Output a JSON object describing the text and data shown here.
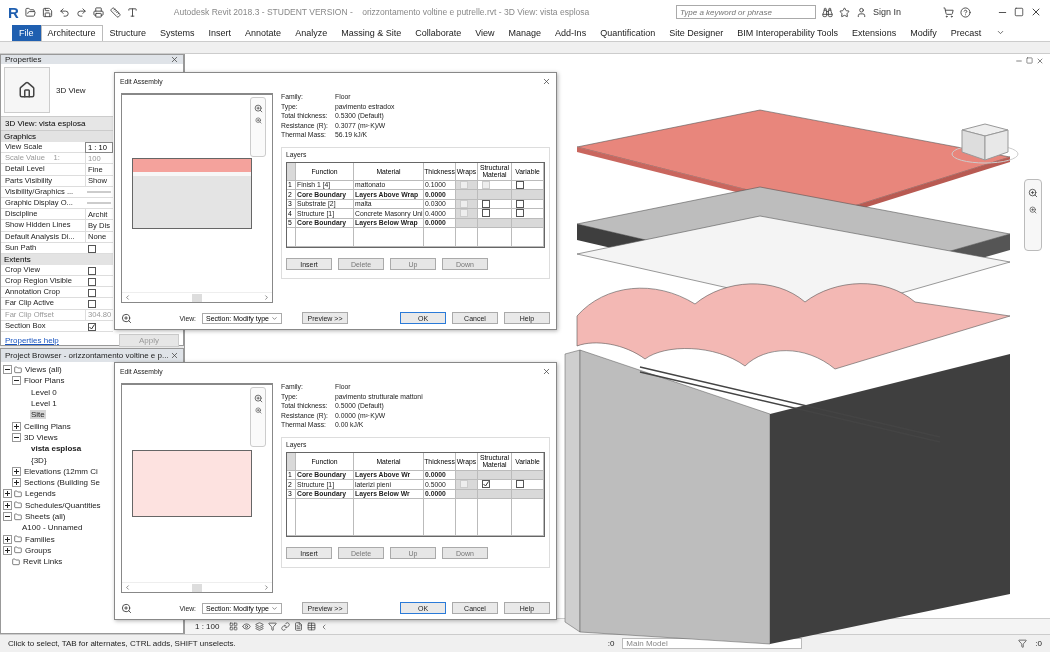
{
  "title_bar": {
    "logo": "R",
    "title": "Autodesk Revit 2018.3 - STUDENT VERSION -    orizzontamento voltine e putrelle.rvt - 3D View: vista esplosa",
    "search": {
      "placeholder": "Type a keyword or phrase"
    },
    "sign_in": "Sign In"
  },
  "ribbon_tabs": [
    {
      "label": "File",
      "kind": "file",
      "selected": false
    },
    {
      "label": "Architecture",
      "kind": "tab",
      "selected": true
    },
    {
      "label": "Structure",
      "kind": "tab",
      "selected": false
    },
    {
      "label": "Systems",
      "kind": "tab",
      "selected": false
    },
    {
      "label": "Insert",
      "kind": "tab",
      "selected": false
    },
    {
      "label": "Annotate",
      "kind": "tab",
      "selected": false
    },
    {
      "label": "Analyze",
      "kind": "tab",
      "selected": false
    },
    {
      "label": "Massing & Site",
      "kind": "tab",
      "selected": false
    },
    {
      "label": "Collaborate",
      "kind": "tab",
      "selected": false
    },
    {
      "label": "View",
      "kind": "tab",
      "selected": false
    },
    {
      "label": "Manage",
      "kind": "tab",
      "selected": false
    },
    {
      "label": "Add-Ins",
      "kind": "tab",
      "selected": false
    },
    {
      "label": "Quantification",
      "kind": "tab",
      "selected": false
    },
    {
      "label": "Site Designer",
      "kind": "tab",
      "selected": false
    },
    {
      "label": "BIM Interoperability Tools",
      "kind": "tab",
      "selected": false
    },
    {
      "label": "Extensions",
      "kind": "tab",
      "selected": false
    },
    {
      "label": "Modify",
      "kind": "tab",
      "selected": false
    },
    {
      "label": "Precast",
      "kind": "tab",
      "selected": false
    }
  ],
  "properties": {
    "title": "Properties",
    "type_name": "3D View",
    "instance": "3D View: vista esplosa",
    "help": "Properties help",
    "apply": "Apply",
    "sections": [
      {
        "label": "Graphics",
        "rows": [
          {
            "label": "View Scale",
            "kind": "field",
            "value": "1 : 10",
            "disabled": false
          },
          {
            "label": "Scale Value    1:",
            "kind": "text",
            "value": "100",
            "disabled": true
          },
          {
            "label": "Detail Level",
            "kind": "text",
            "value": "Fine",
            "disabled": false
          },
          {
            "label": "Parts Visibility",
            "kind": "text",
            "value": "Show",
            "disabled": false
          },
          {
            "label": "Visibility/Graphics ...",
            "kind": "edit",
            "disabled": false
          },
          {
            "label": "Graphic Display O...",
            "kind": "edit",
            "disabled": false
          },
          {
            "label": "Discipline",
            "kind": "text",
            "value": "Archit",
            "disabled": false
          },
          {
            "label": "Show Hidden Lines",
            "kind": "text",
            "value": "By Dis",
            "disabled": false
          },
          {
            "label": "Default Analysis Di...",
            "kind": "text",
            "value": "None",
            "disabled": false
          },
          {
            "label": "Sun Path",
            "kind": "check",
            "checked": false,
            "disabled": false
          }
        ]
      },
      {
        "label": "Extents",
        "rows": [
          {
            "label": "Crop View",
            "kind": "check",
            "checked": false,
            "disabled": false
          },
          {
            "label": "Crop Region Visible",
            "kind": "check",
            "checked": false,
            "disabled": false
          },
          {
            "label": "Annotation Crop",
            "kind": "check",
            "checked": false,
            "disabled": false
          },
          {
            "label": "Far Clip Active",
            "kind": "check",
            "checked": false,
            "disabled": false
          },
          {
            "label": "Far Clip Offset",
            "kind": "text",
            "value": "304.80",
            "disabled": true
          },
          {
            "label": "Section Box",
            "kind": "check",
            "checked": true,
            "disabled": false
          }
        ]
      }
    ]
  },
  "project_browser": {
    "title": "Project Browser - orizzontamento voltine e p...",
    "tree": [
      {
        "label": "Views (all)",
        "expanded": true,
        "selected": false,
        "current": false,
        "children": [
          {
            "label": "Floor Plans",
            "expanded": true,
            "selected": false,
            "current": false,
            "children": [
              {
                "label": "Level 0",
                "selected": false,
                "current": false
              },
              {
                "label": "Level 1",
                "selected": false,
                "current": false
              },
              {
                "label": "Site",
                "selected": true,
                "current": false
              }
            ]
          },
          {
            "label": "Ceiling Plans",
            "expanded": false,
            "selected": false,
            "current": false
          },
          {
            "label": "3D Views",
            "expanded": true,
            "selected": false,
            "current": false,
            "children": [
              {
                "label": "vista esplosa",
                "selected": false,
                "current": true
              },
              {
                "label": "{3D}",
                "selected": false,
                "current": false
              }
            ]
          },
          {
            "label": "Elevations (12mm Ci",
            "expanded": false,
            "selected": false,
            "current": false
          },
          {
            "label": "Sections (Building Se",
            "expanded": false,
            "selected": false,
            "current": false
          }
        ]
      },
      {
        "label": "Legends",
        "expanded": false,
        "selected": false,
        "current": false
      },
      {
        "label": "Schedules/Quantities",
        "expanded": false,
        "selected": false,
        "current": false
      },
      {
        "label": "Sheets (all)",
        "expanded": true,
        "selected": false,
        "current": false,
        "children": [
          {
            "label": "A100 - Unnamed",
            "selected": false,
            "current": false
          }
        ]
      },
      {
        "label": "Families",
        "expanded": false,
        "selected": false,
        "current": false
      },
      {
        "label": "Groups",
        "expanded": false,
        "selected": false,
        "current": false
      },
      {
        "label": "Revit Links",
        "selected": false,
        "current": false
      }
    ]
  },
  "dialogs": [
    {
      "title": "Edit Assembly",
      "info": [
        {
          "label": "Family:",
          "value": "Floor"
        },
        {
          "label": "Type:",
          "value": "pavimento estradox"
        },
        {
          "label": "Total thickness:",
          "value": "0.5300 (Default)"
        },
        {
          "label": "Resistance (R):",
          "value": "0.3077 (m²·K)/W"
        },
        {
          "label": "Thermal Mass:",
          "value": "56.19 kJ/K"
        }
      ],
      "layers_label": "Layers",
      "columns": [
        "Function",
        "Material",
        "Thickness",
        "Wraps",
        "Structural Material",
        "Variable"
      ],
      "layers": [
        {
          "kind": "layer",
          "num": "1",
          "function": "Finish 1 [4]",
          "material": "mattonato",
          "thickness": "0.1000",
          "color": "#f4a29c",
          "wraps": {
            "checked": false,
            "disabled": true
          },
          "structural": {
            "checked": false,
            "disabled": true
          },
          "variable": {
            "checked": false,
            "disabled": false
          }
        },
        {
          "kind": "boundary",
          "num": "2",
          "function": "Core Boundary",
          "material": "Layers Above Wrap",
          "thickness": "0.0000"
        },
        {
          "kind": "layer",
          "num": "3",
          "function": "Substrate [2]",
          "material": "malta",
          "thickness": "0.0300",
          "color": "#f7f7f7",
          "wraps": {
            "checked": false,
            "disabled": true
          },
          "structural": {
            "checked": false,
            "disabled": false
          },
          "variable": {
            "checked": false,
            "disabled": false
          }
        },
        {
          "kind": "layer",
          "num": "4",
          "function": "Structure [1]",
          "material": "Concrete Masonry Uni",
          "thickness": "0.4000",
          "color": "#e4e4e4",
          "wraps": {
            "checked": false,
            "disabled": true
          },
          "structural": {
            "checked": false,
            "disabled": false
          },
          "variable": {
            "checked": false,
            "disabled": false
          }
        },
        {
          "kind": "boundary",
          "num": "5",
          "function": "Core Boundary",
          "material": "Layers Below Wrap",
          "thickness": "0.0000"
        }
      ],
      "layer_buttons": [
        {
          "label": "Insert",
          "disabled": false
        },
        {
          "label": "Delete",
          "disabled": true
        },
        {
          "label": "Up",
          "disabled": true
        },
        {
          "label": "Down",
          "disabled": true
        }
      ],
      "view_label": "View:",
      "view_value": "Section: Modify type",
      "preview_button": "Preview >>",
      "buttons": [
        {
          "label": "OK",
          "default": true
        },
        {
          "label": "Cancel",
          "default": false
        },
        {
          "label": "Help",
          "default": false
        }
      ]
    },
    {
      "title": "Edit Assembly",
      "info": [
        {
          "label": "Family:",
          "value": "Floor"
        },
        {
          "label": "Type:",
          "value": "pavimento strutturale mattoni"
        },
        {
          "label": "Total thickness:",
          "value": "0.5000 (Default)"
        },
        {
          "label": "Resistance (R):",
          "value": "0.0000 (m²·K)/W"
        },
        {
          "label": "Thermal Mass:",
          "value": "0.00 kJ/K"
        }
      ],
      "layers_label": "Layers",
      "columns": [
        "Function",
        "Material",
        "Thickness",
        "Wraps",
        "Structural Material",
        "Variable"
      ],
      "layers": [
        {
          "kind": "boundary",
          "num": "1",
          "function": "Core Boundary",
          "material": "Layers Above Wr",
          "thickness": "0.0000"
        },
        {
          "kind": "layer",
          "num": "2",
          "function": "Structure [1]",
          "material": "laterizi pieni",
          "thickness": "0.5000",
          "color": "#fde2e0",
          "wraps": {
            "checked": false,
            "disabled": true
          },
          "structural": {
            "checked": true,
            "disabled": false
          },
          "variable": {
            "checked": false,
            "disabled": false
          }
        },
        {
          "kind": "boundary",
          "num": "3",
          "function": "Core Boundary",
          "material": "Layers Below Wr",
          "thickness": "0.0000"
        }
      ],
      "layer_buttons": [
        {
          "label": "Insert",
          "disabled": false
        },
        {
          "label": "Delete",
          "disabled": true
        },
        {
          "label": "Up",
          "disabled": true
        },
        {
          "label": "Down",
          "disabled": true
        }
      ],
      "view_label": "View:",
      "view_value": "Section: Modify type",
      "preview_button": "Preview >>",
      "buttons": [
        {
          "label": "OK",
          "default": true
        },
        {
          "label": "Cancel",
          "default": false
        },
        {
          "label": "Help",
          "default": false
        }
      ]
    }
  ],
  "view_bar": {
    "scale": "1 : 100"
  },
  "status_bar": {
    "hint": "Click to select, TAB for alternates, CTRL adds, SHIFT unselects.",
    "select_count": ":0",
    "workset": "Main Model",
    "filter_count": ":0"
  }
}
